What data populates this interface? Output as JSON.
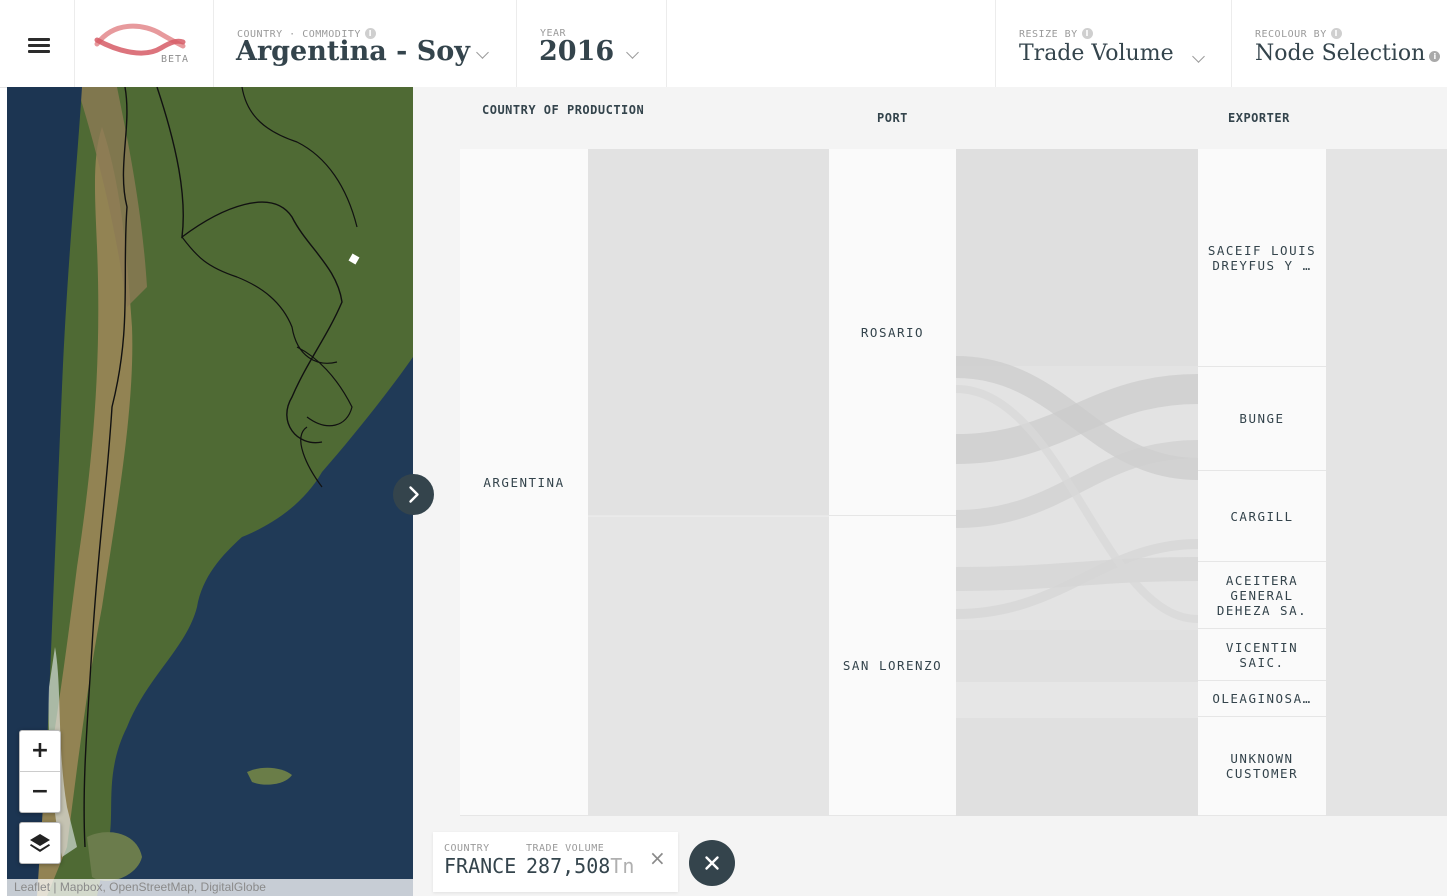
{
  "nav": {
    "logo_badge": "BETA",
    "commodity_selector": {
      "label": "COUNTRY · COMMODITY",
      "value": "Argentina - Soy"
    },
    "year_selector": {
      "label": "YEAR",
      "value": "2016"
    },
    "resize_selector": {
      "label": "RESIZE BY",
      "value": "Trade Volume"
    },
    "recolour_selector": {
      "label": "RECOLOUR BY",
      "value": "Node Selection"
    },
    "info_glyph": "i"
  },
  "map": {
    "zoom_in": "+",
    "zoom_out": "−",
    "attribution": "Leaflet | Mapbox, OpenStreetMap, DigitalGlobe",
    "colors": {
      "ocean": "#203a57",
      "land": "#4f6a34",
      "arid": "#9d8759",
      "border": "#111111"
    }
  },
  "sankey": {
    "columns": [
      {
        "title": "COUNTRY OF PRODUCTION"
      },
      {
        "title": "PORT"
      },
      {
        "title": "EXPORTER"
      }
    ],
    "nodes": {
      "country": [
        "ARGENTINA"
      ],
      "ports": [
        "ROSARIO",
        "SAN LORENZO"
      ],
      "exporters": [
        "SACEIF LOUIS DREYFUS Y …",
        "BUNGE",
        "CARGILL",
        "ACEITERA GENERAL DEHEZA SA.",
        "VICENTIN SAIC.",
        "OLEAGINOSA…",
        "UNKNOWN CUSTOMER"
      ]
    },
    "colors": {
      "node": "#fafafa",
      "flow": "#dedede",
      "flow_selected": "#c9c9c9",
      "background": "#f4f4f4"
    }
  },
  "selection": {
    "country_label": "COUNTRY",
    "country_value": "FRANCE",
    "volume_label": "TRADE VOLUME",
    "volume_value": "287,508",
    "volume_unit": "Tn",
    "remove_glyph": "×"
  }
}
